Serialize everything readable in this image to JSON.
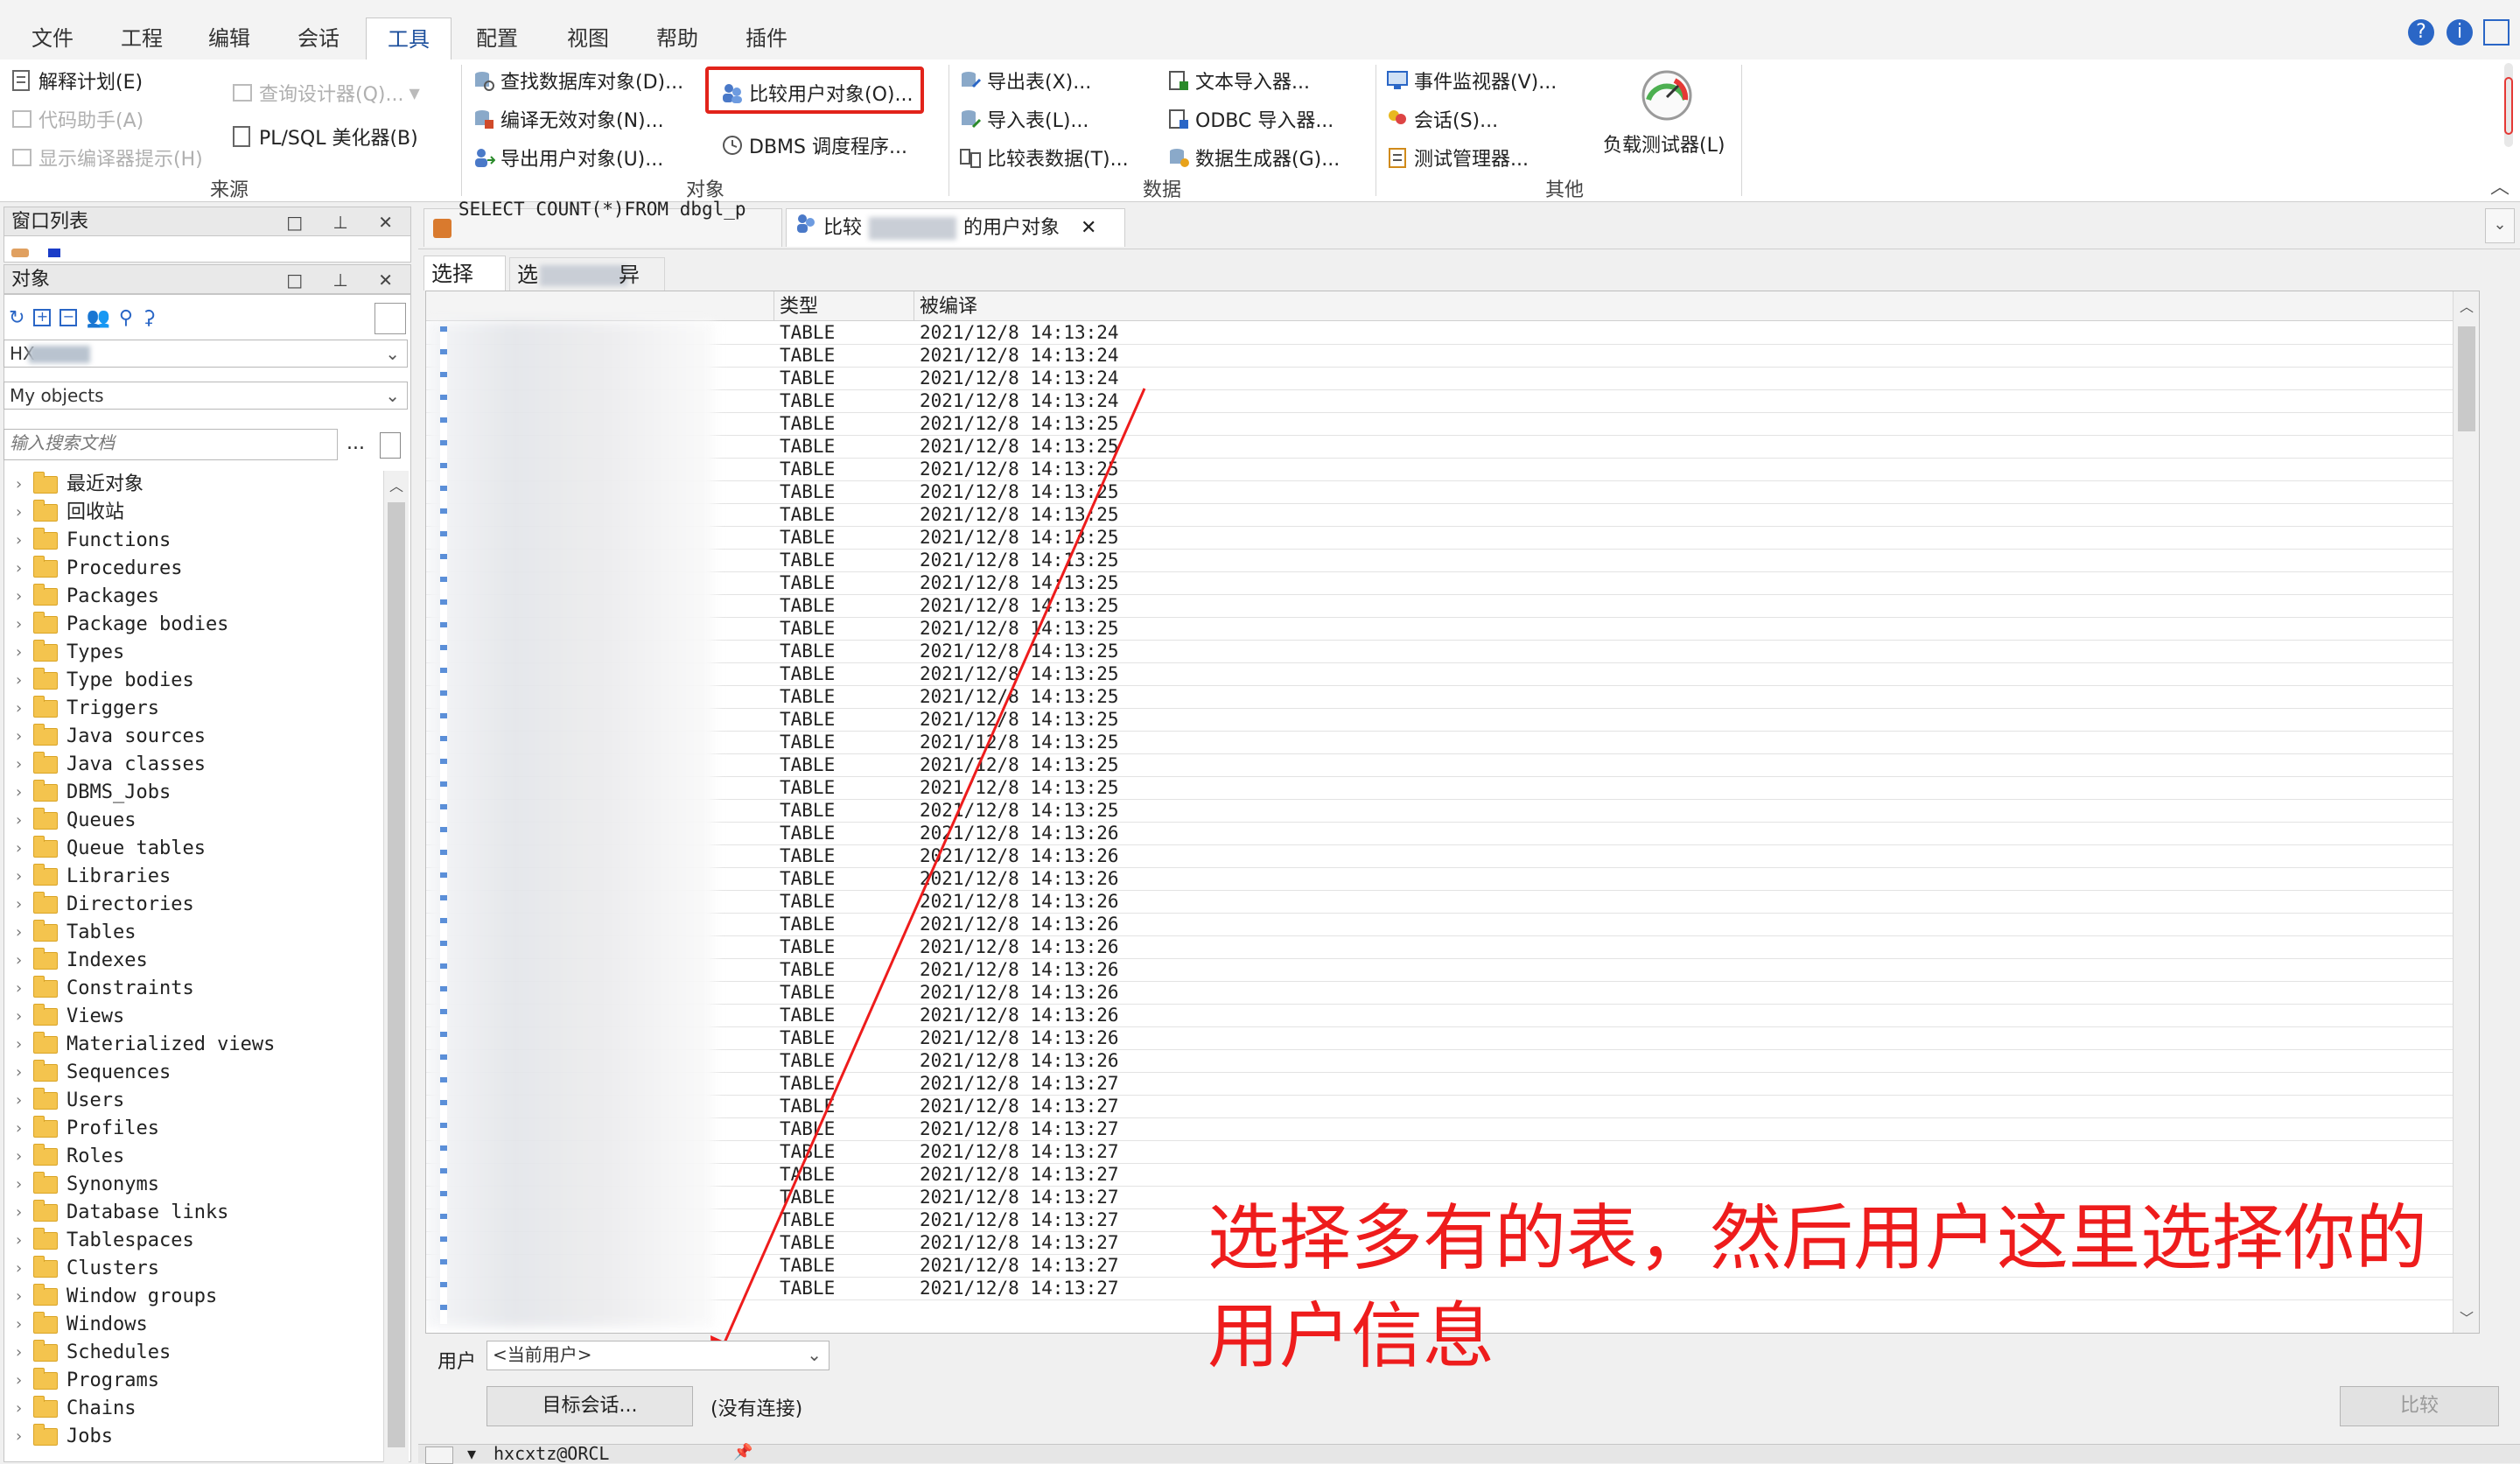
{
  "menu": [
    "文件",
    "工程",
    "编辑",
    "会话",
    "工具",
    "配置",
    "视图",
    "帮助",
    "插件"
  ],
  "active_menu": "工具",
  "ribbon": {
    "source": {
      "items": [
        "解释计划(E)",
        "代码助手(A)",
        "显示编译器提示(H)",
        "查询设计器(Q)...",
        "PL/SQL 美化器(B)"
      ],
      "label": "来源"
    },
    "objects": {
      "items": [
        "查找数据库对象(D)...",
        "编译无效对象(N)...",
        "导出用户对象(U)...",
        "比较用户对象(O)...",
        "DBMS 调度程序..."
      ],
      "label": "对象"
    },
    "data": {
      "items": [
        "导出表(X)...",
        "导入表(L)...",
        "比较表数据(T)...",
        "文本导入器...",
        "ODBC 导入器...",
        "数据生成器(G)..."
      ],
      "label": "数据"
    },
    "other": {
      "items": [
        "事件监视器(V)...",
        "会话(S)...",
        "测试管理器...",
        "负载测试器(L)"
      ],
      "label": "其他"
    }
  },
  "window_list_title": "窗口列表",
  "objects_panel": {
    "title": "对象",
    "schema_value": "HX",
    "filter_value": "My objects",
    "search_placeholder": "输入搜索文档",
    "tree": [
      "最近对象",
      "回收站",
      "Functions",
      "Procedures",
      "Packages",
      "Package bodies",
      "Types",
      "Type bodies",
      "Triggers",
      "Java sources",
      "Java classes",
      "DBMS_Jobs",
      "Queues",
      "Queue tables",
      "Libraries",
      "Directories",
      "Tables",
      "Indexes",
      "Constraints",
      "Views",
      "Materialized views",
      "Sequences",
      "Users",
      "Profiles",
      "Roles",
      "Synonyms",
      "Database links",
      "Tablespaces",
      "Clusters",
      "Window groups",
      "Windows",
      "Schedules",
      "Programs",
      "Chains",
      "Jobs"
    ]
  },
  "tabs": {
    "sql_tab": "SELECT COUNT(*)FROM dbgl_p ...",
    "compare_tab_prefix": "比较",
    "compare_tab_suffix": "的用户对象",
    "close_glyph": "✕"
  },
  "subtabs": [
    "选择",
    "选",
    "异"
  ],
  "grid": {
    "headers": [
      "类型",
      "被编译"
    ],
    "rows": [
      [
        "TABLE",
        "2021/12/8  14:13:24"
      ],
      [
        "TABLE",
        "2021/12/8  14:13:24"
      ],
      [
        "TABLE",
        "2021/12/8  14:13:24"
      ],
      [
        "TABLE",
        "2021/12/8  14:13:24"
      ],
      [
        "TABLE",
        "2021/12/8  14:13:25"
      ],
      [
        "TABLE",
        "2021/12/8  14:13:25"
      ],
      [
        "TABLE",
        "2021/12/8  14:13:25"
      ],
      [
        "TABLE",
        "2021/12/8  14:13:25"
      ],
      [
        "TABLE",
        "2021/12/8  14:13:25"
      ],
      [
        "TABLE",
        "2021/12/8  14:13:25"
      ],
      [
        "TABLE",
        "2021/12/8  14:13:25"
      ],
      [
        "TABLE",
        "2021/12/8  14:13:25"
      ],
      [
        "TABLE",
        "2021/12/8  14:13:25"
      ],
      [
        "TABLE",
        "2021/12/8  14:13:25"
      ],
      [
        "TABLE",
        "2021/12/8  14:13:25"
      ],
      [
        "TABLE",
        "2021/12/8  14:13:25"
      ],
      [
        "TABLE",
        "2021/12/8  14:13:25"
      ],
      [
        "TABLE",
        "2021/12/8  14:13:25"
      ],
      [
        "TABLE",
        "2021/12/8  14:13:25"
      ],
      [
        "TABLE",
        "2021/12/8  14:13:25"
      ],
      [
        "TABLE",
        "2021/12/8  14:13:25"
      ],
      [
        "TABLE",
        "2021/12/8  14:13:25"
      ],
      [
        "TABLE",
        "2021/12/8  14:13:26"
      ],
      [
        "TABLE",
        "2021/12/8  14:13:26"
      ],
      [
        "TABLE",
        "2021/12/8  14:13:26"
      ],
      [
        "TABLE",
        "2021/12/8  14:13:26"
      ],
      [
        "TABLE",
        "2021/12/8  14:13:26"
      ],
      [
        "TABLE",
        "2021/12/8  14:13:26"
      ],
      [
        "TABLE",
        "2021/12/8  14:13:26"
      ],
      [
        "TABLE",
        "2021/12/8  14:13:26"
      ],
      [
        "TABLE",
        "2021/12/8  14:13:26"
      ],
      [
        "TABLE",
        "2021/12/8  14:13:26"
      ],
      [
        "TABLE",
        "2021/12/8  14:13:26"
      ],
      [
        "TABLE",
        "2021/12/8  14:13:27"
      ],
      [
        "TABLE",
        "2021/12/8  14:13:27"
      ],
      [
        "TABLE",
        "2021/12/8  14:13:27"
      ],
      [
        "TABLE",
        "2021/12/8  14:13:27"
      ],
      [
        "TABLE",
        "2021/12/8  14:13:27"
      ],
      [
        "TABLE",
        "2021/12/8  14:13:27"
      ],
      [
        "TABLE",
        "2021/12/8  14:13:27"
      ],
      [
        "TABLE",
        "2021/12/8  14:13:27"
      ],
      [
        "TABLE",
        "2021/12/8  14:13:27"
      ],
      [
        "TABLE",
        "2021/12/8  14:13:27"
      ]
    ]
  },
  "user_label": "用户",
  "user_select_value": "<当前用户>",
  "target_session_button": "目标会话...",
  "connection_status": "(没有连接)",
  "compare_button": "比较",
  "session_bar": "hxcxtz@ORCL",
  "annotation": [
    "选择多有的表，然后用户这里选择你的",
    "用户信息"
  ],
  "colors": {
    "annotation_red": "#ee1c1c",
    "highlight_box": "#e2231a",
    "accent_blue": "#1c4f9c"
  }
}
